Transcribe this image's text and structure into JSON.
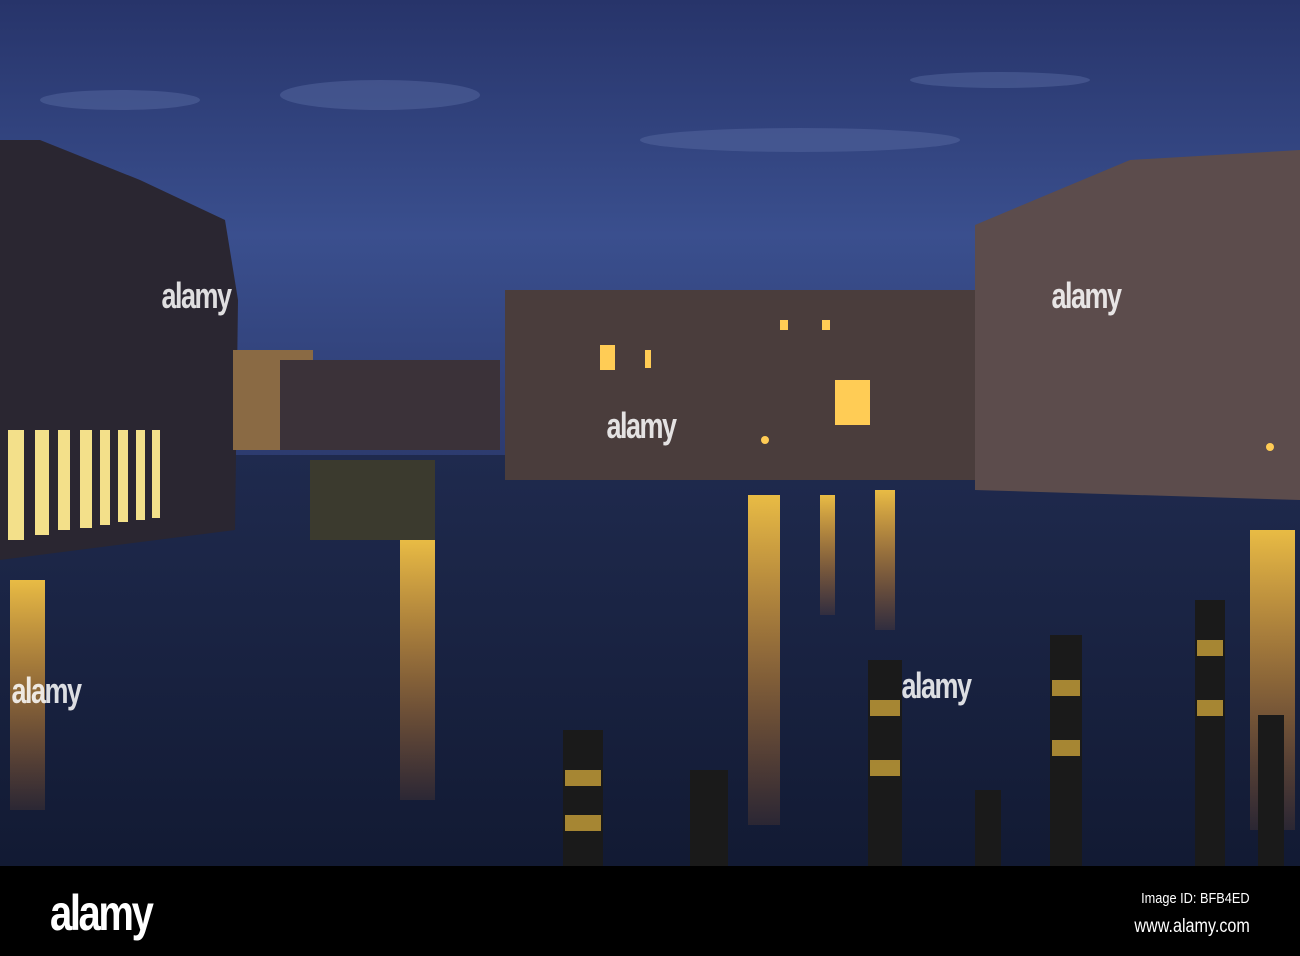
{
  "watermark": {
    "text": "alamy"
  },
  "footer": {
    "logo": "alamy",
    "image_id": "Image ID: BFB4ED",
    "website": "www.alamy.com"
  }
}
